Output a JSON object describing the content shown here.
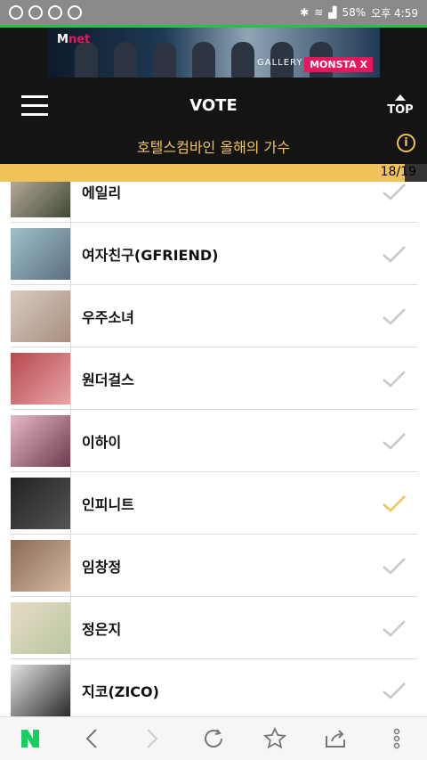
{
  "status": {
    "battery": "58%",
    "time": "오후 4:59"
  },
  "banner": {
    "brand": "M",
    "brand_suffix": "net",
    "gallery": "GALLERY",
    "artist": "MONSTA X"
  },
  "header": {
    "title": "VOTE",
    "top_label": "TOP",
    "category": "호텔스컴바인 올해의 가수",
    "progress": "18/19",
    "progress_value": 0.947
  },
  "items": [
    {
      "name": "에일리",
      "selected": false
    },
    {
      "name": "여자친구(GFRIEND)",
      "selected": false
    },
    {
      "name": "우주소녀",
      "selected": false
    },
    {
      "name": "원더걸스",
      "selected": false
    },
    {
      "name": "이하이",
      "selected": false
    },
    {
      "name": "인피니트",
      "selected": true
    },
    {
      "name": "임창정",
      "selected": false
    },
    {
      "name": "정은지",
      "selected": false
    },
    {
      "name": "지코(ZICO)",
      "selected": false
    }
  ],
  "colors": {
    "accent": "#f0c35a",
    "check_inactive": "#c8c8c8",
    "header_bg": "#141414",
    "naver_green": "#19ce60"
  },
  "bottom_icons": [
    "naver-n-icon",
    "back-arrow-icon",
    "forward-arrow-icon",
    "refresh-icon",
    "star-icon",
    "share-icon",
    "more-vertical-icon"
  ]
}
